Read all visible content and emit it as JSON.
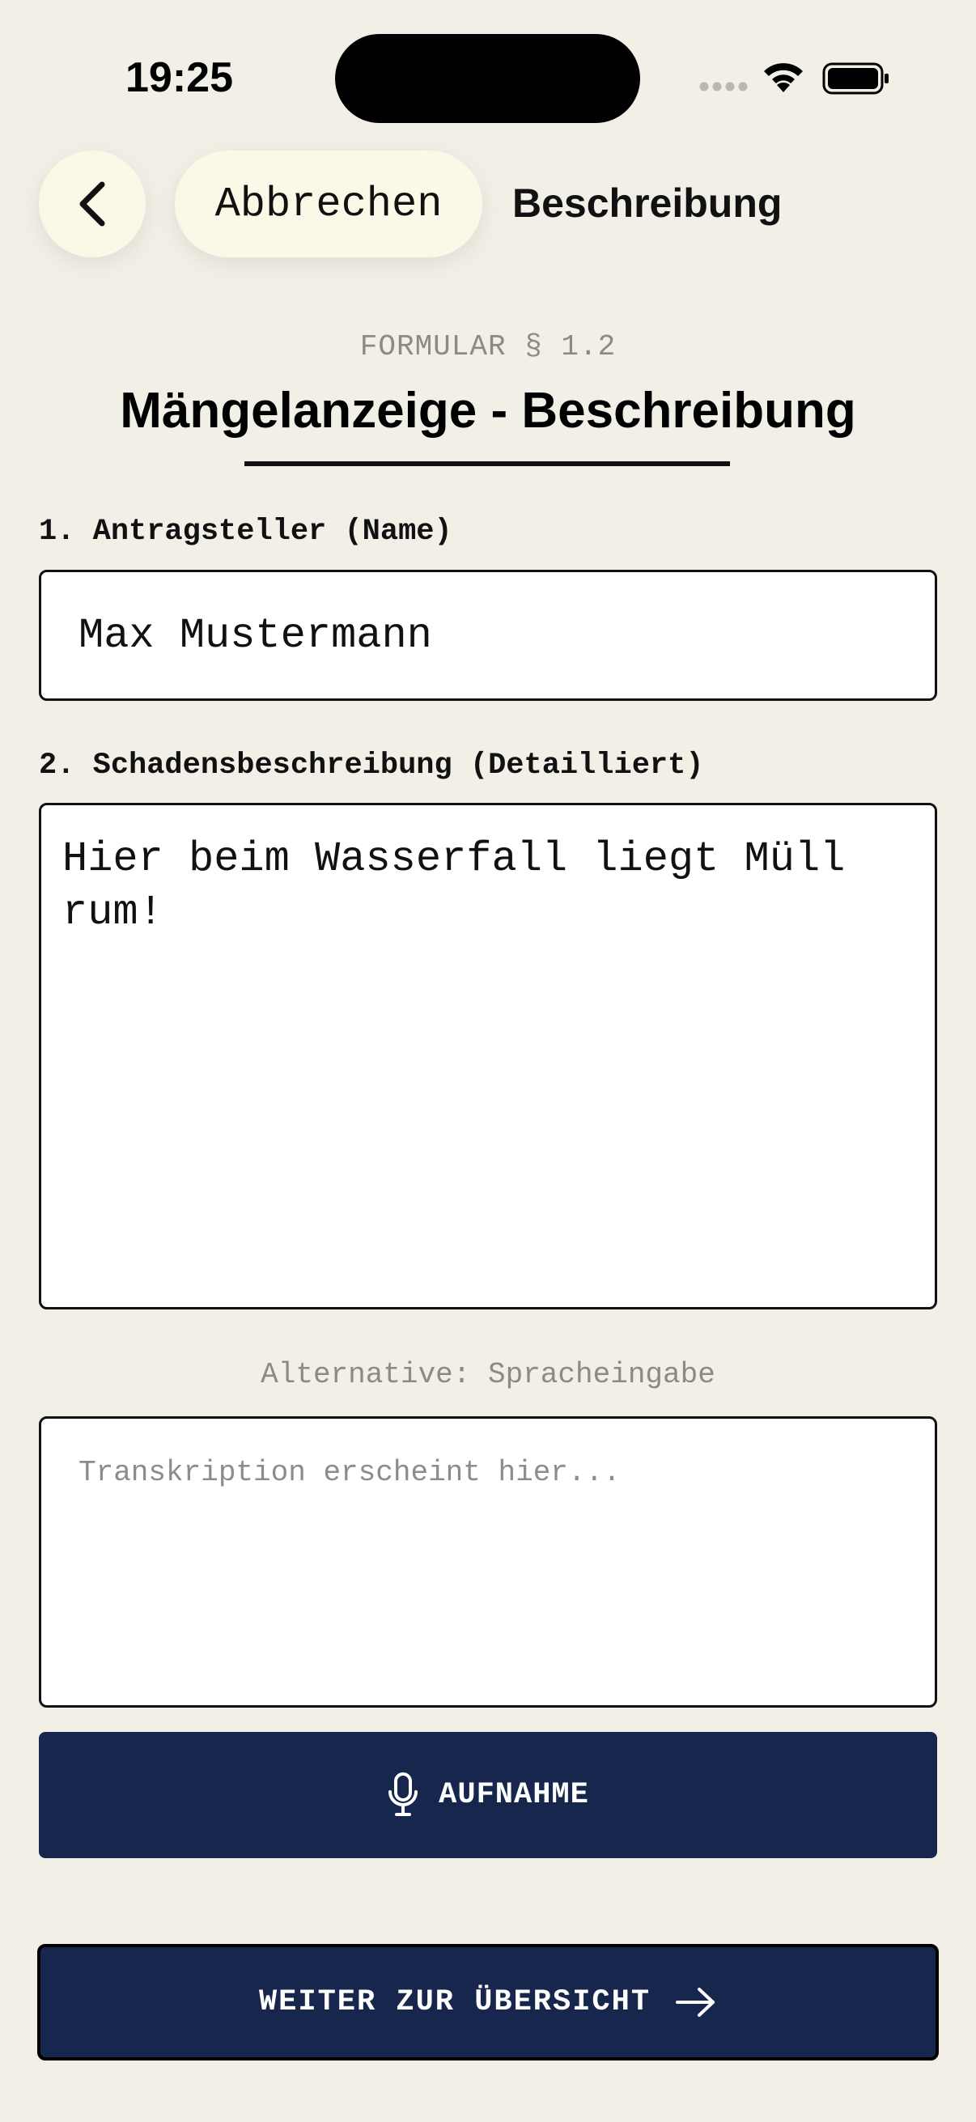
{
  "status_bar": {
    "time": "19:25"
  },
  "nav": {
    "back_icon": "chevron-left-icon",
    "cancel_label": "Abbrechen",
    "title": "Beschreibung"
  },
  "header": {
    "kicker": "FORMULAR § 1.2",
    "title": "Mängelanzeige - Beschreibung"
  },
  "form": {
    "applicant_label": "1. Antragsteller (Name)",
    "applicant_value": "Max Mustermann",
    "description_label": "2. Schadensbeschreibung (Detailliert)",
    "description_value": "Hier beim Wasserfall liegt Müll rum!",
    "voice_label": "Alternative: Spracheingabe",
    "transcript_placeholder": "Transkription erscheint hier..."
  },
  "actions": {
    "record_label": "AUFNAHME",
    "record_icon": "microphone-icon",
    "next_label": "WEITER ZUR ÜBERSICHT",
    "next_icon": "arrow-right-icon"
  },
  "colors": {
    "background": "#f2efe7",
    "pill": "#fbf8e8",
    "primary": "#17264d",
    "muted_text": "#8c8a86"
  }
}
